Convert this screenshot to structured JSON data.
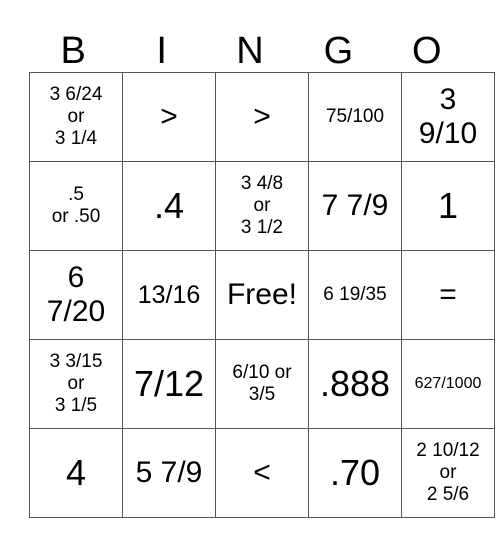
{
  "header": [
    "B",
    "I",
    "N",
    "G",
    "O"
  ],
  "rows": [
    [
      {
        "text": "3 6/24\nor\n3 1/4",
        "size": "s-sm"
      },
      {
        "text": ">",
        "size": "s-lg"
      },
      {
        "text": ">",
        "size": "s-lg"
      },
      {
        "text": "75/100",
        "size": "s-sm"
      },
      {
        "text": "3\n9/10",
        "size": "s-lg"
      }
    ],
    [
      {
        "text": ".5\nor .50",
        "size": "s-sm"
      },
      {
        "text": ".4",
        "size": "s-xl"
      },
      {
        "text": "3 4/8\nor\n3 1/2",
        "size": "s-sm"
      },
      {
        "text": "7 7/9",
        "size": "s-lg"
      },
      {
        "text": "1",
        "size": "s-xl"
      }
    ],
    [
      {
        "text": "6\n7/20",
        "size": "s-lg"
      },
      {
        "text": "13/16",
        "size": "s-md"
      },
      {
        "text": "Free!",
        "size": "s-lg"
      },
      {
        "text": "6 19/35",
        "size": "s-sm"
      },
      {
        "text": "=",
        "size": "s-lg"
      }
    ],
    [
      {
        "text": "3 3/15\nor\n3 1/5",
        "size": "s-sm"
      },
      {
        "text": "7/12",
        "size": "s-xl"
      },
      {
        "text": "6/10 or\n3/5",
        "size": "s-sm"
      },
      {
        "text": ".888",
        "size": "s-xl"
      },
      {
        "text": "627/1000",
        "size": "s-xs"
      }
    ],
    [
      {
        "text": "4",
        "size": "s-xl"
      },
      {
        "text": "5 7/9",
        "size": "s-lg"
      },
      {
        "text": "<",
        "size": "s-lg"
      },
      {
        "text": ".70",
        "size": "s-xl"
      },
      {
        "text": "2 10/12\nor\n2 5/6",
        "size": "s-sm"
      }
    ]
  ]
}
